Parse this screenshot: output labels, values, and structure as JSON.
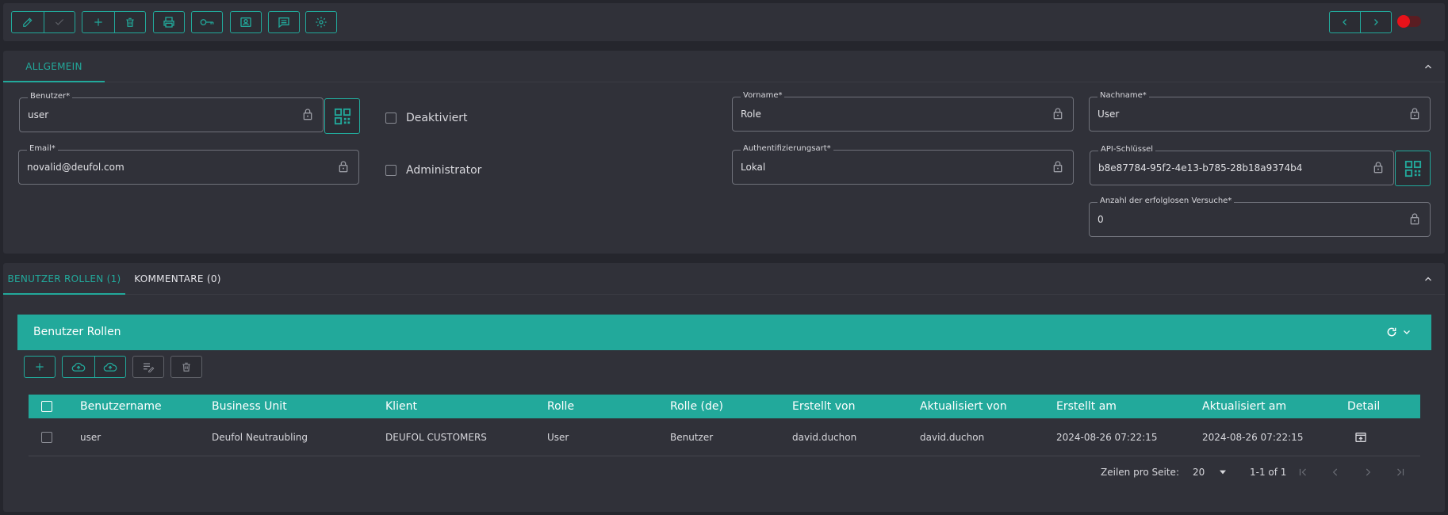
{
  "toolbar": {
    "icons": [
      "pencil-icon",
      "check-icon",
      "plus-icon",
      "trash-icon",
      "printer-icon",
      "key-icon",
      "contact-card-icon",
      "comment-icon",
      "gear-icon"
    ],
    "nav_icons": [
      "chevron-left-icon",
      "chevron-right-icon"
    ],
    "toggle_color": "#e8121a"
  },
  "general_section": {
    "tab_label": "ALLGEMEIN",
    "fields": {
      "benutzer": {
        "label": "Benutzer*",
        "value": "user"
      },
      "email": {
        "label": "Email*",
        "value": "novalid@deufol.com"
      },
      "deaktiviert": {
        "label": "Deaktiviert"
      },
      "administrator": {
        "label": "Administrator"
      },
      "vorname": {
        "label": "Vorname*",
        "value": "Role"
      },
      "auth_art": {
        "label": "Authentifizierungsart*",
        "value": "Lokal"
      },
      "nachname": {
        "label": "Nachname*",
        "value": "User"
      },
      "api_key": {
        "label": "API-Schlüssel",
        "value": "b8e87784-95f2-4e13-b785-28b18a9374b4"
      },
      "failed_attempts": {
        "label": "Anzahl der erfolglosen Versuche*",
        "value": "0"
      }
    }
  },
  "roles_section": {
    "tabs": [
      {
        "label": "BENUTZER ROLLEN (1)",
        "active": true
      },
      {
        "label": "KOMMENTARE (0)",
        "active": false
      }
    ],
    "grid_title": "Benutzer Rollen",
    "columns": [
      "Benutzername",
      "Business Unit",
      "Klient",
      "Rolle",
      "Rolle (de)",
      "Erstellt von",
      "Aktualisiert von",
      "Erstellt am",
      "Aktualisiert am",
      "Detail"
    ],
    "rows": [
      [
        "user",
        "Deufol Neutraubling",
        "DEUFOL CUSTOMERS",
        "User",
        "Benutzer",
        "david.duchon",
        "david.duchon",
        "2024-08-26 07:22:15",
        "2024-08-26 07:22:15"
      ]
    ],
    "pagination": {
      "rows_per_page_label": "Zeilen pro Seite:",
      "rows_per_page": "20",
      "range": "1-1 of 1"
    }
  },
  "colors": {
    "accent": "#22a99b",
    "background": "#25262d",
    "panel": "#303139"
  }
}
